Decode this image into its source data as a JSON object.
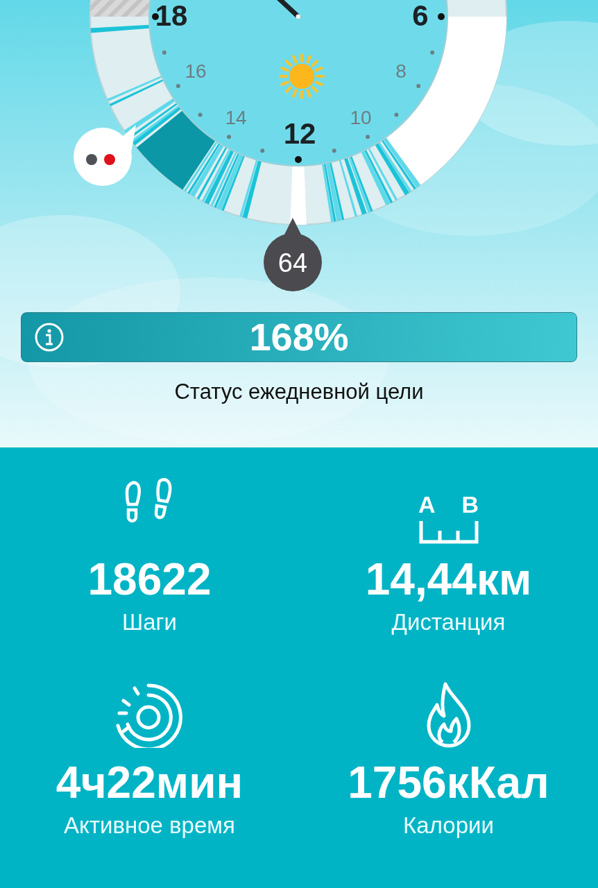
{
  "clock": {
    "hour_labels": [
      {
        "text": "18",
        "kind": "major"
      },
      {
        "text": "6",
        "kind": "major"
      },
      {
        "text": "16",
        "kind": "minor"
      },
      {
        "text": "8",
        "kind": "minor"
      },
      {
        "text": "14",
        "kind": "minor"
      },
      {
        "text": "10",
        "kind": "minor"
      },
      {
        "text": "12",
        "kind": "major"
      }
    ],
    "badge": "64"
  },
  "goal": {
    "percent": "168%",
    "level": 1,
    "label": "Статус ежедневной цели"
  },
  "distance_icon": {
    "letters": [
      "A",
      "B"
    ]
  },
  "stats": [
    {
      "kind": "steps",
      "value": "18622",
      "label": "Шаги"
    },
    {
      "kind": "distance",
      "value": "14,44км",
      "label": "Дистанция"
    },
    {
      "kind": "active",
      "value": "4ч22мин",
      "label": "Активное время"
    },
    {
      "kind": "calories",
      "value": "1756кКал",
      "label": "Калории"
    }
  ]
}
